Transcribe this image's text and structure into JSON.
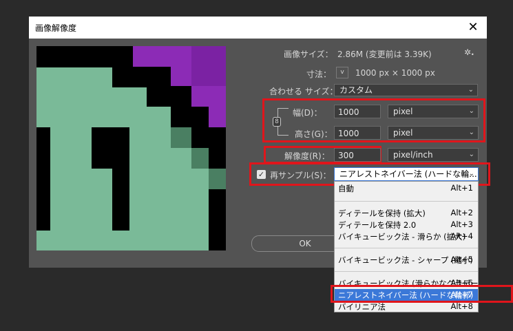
{
  "dialog": {
    "title": "画像解像度",
    "close_glyph": "✕"
  },
  "info": {
    "image_size_label": "画像サイズ：",
    "image_size_value": "2.86M (変更前は 3.39K)",
    "gear_glyph": "✲.",
    "dimensions_label": "寸法：",
    "dimensions_value": "1000 px × 1000 px",
    "fit_label": "合わせる サイズ：",
    "fit_value": "カスタム"
  },
  "size": {
    "width_label": "幅(D)：",
    "width_value": "1000",
    "width_unit": "pixel",
    "height_label": "高さ(G)：",
    "height_value": "1000",
    "height_unit": "pixel",
    "resolution_label": "解像度(R)：",
    "resolution_value": "300",
    "resolution_unit": "pixel/inch"
  },
  "resample": {
    "checked": true,
    "label": "再サンプル(S)：",
    "value": "ニアレストネイバー法 (ハードな輪..."
  },
  "buttons": {
    "ok": "OK"
  },
  "menu": {
    "items": [
      {
        "label": "自動",
        "shortcut": "Alt+1"
      },
      {
        "label": "ディテールを保持 (拡大)",
        "shortcut": "Alt+2"
      },
      {
        "label": "ディテールを保持 2.0",
        "shortcut": "Alt+3"
      },
      {
        "label": "バイキュービック法 - 滑らか (拡大)",
        "shortcut": "Alt+4"
      },
      {
        "label": "バイキュービック法 - シャープ (縮小)",
        "shortcut": "Alt+5"
      },
      {
        "label": "バイキュービック法 (滑らかなグラデーシ...",
        "shortcut": "Alt+6"
      },
      {
        "label": "ニアレストネイバー法 (ハードな輪郭)",
        "shortcut": "Alt+7",
        "selected": true
      },
      {
        "label": "バイリニア法",
        "shortcut": "Alt+8"
      }
    ]
  },
  "colors": {
    "highlight": "#e0151b",
    "selection": "#3b78d8",
    "preview_green": "#7aba98",
    "preview_purple": "#8c2bb6"
  }
}
